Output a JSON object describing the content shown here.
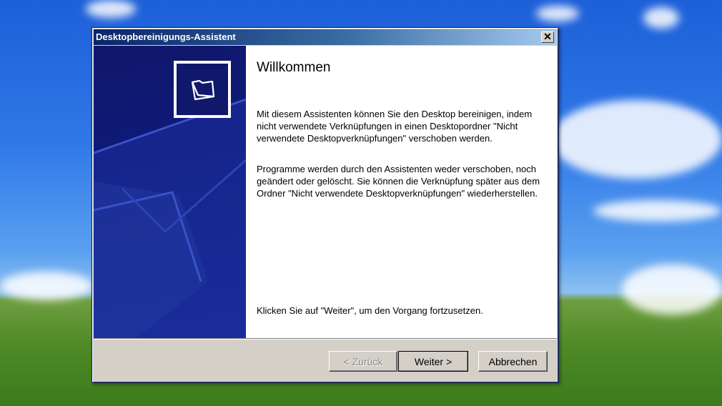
{
  "window": {
    "title": "Desktopbereinigungs-Assistent",
    "close_symbol": "✕"
  },
  "icons": {
    "side_icon": "folder-icon",
    "close_icon": "close-icon"
  },
  "content": {
    "heading": "Willkommen",
    "paragraph1": "Mit diesem Assistenten können Sie den Desktop bereinigen, indem nicht verwendete Verknüpfungen in einen Desktopordner \"Nicht verwendete Desktopverknüpfungen\" verschoben werden.",
    "paragraph2": "Programme werden durch den Assistenten weder verschoben, noch geändert oder gelöscht. Sie können die Verknüpfung später aus dem Ordner \"Nicht verwendete Desktopverknüpfungen\" wiederherstellen.",
    "footer_text": "Klicken Sie auf \"Weiter\", um den Vorgang fortzusetzen."
  },
  "buttons": {
    "back": "< Zurück",
    "next": "Weiter >",
    "cancel": "Abbrechen"
  },
  "colors": {
    "title_bar": "#0a246a",
    "side_panel": "#10186b",
    "dialog_face": "#d4d0c8"
  }
}
